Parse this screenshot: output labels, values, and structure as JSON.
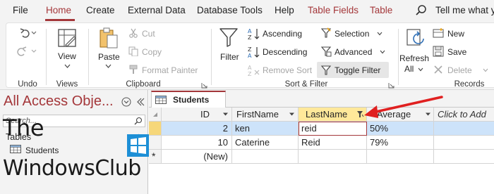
{
  "menubar": {
    "tabs": [
      "File",
      "Home",
      "Create",
      "External Data",
      "Database Tools",
      "Help",
      "Table Fields",
      "Table"
    ],
    "active_tab": "Home",
    "tell_me": "Tell me what y"
  },
  "ribbon": {
    "undo": {
      "group": "Undo"
    },
    "views": {
      "view_label": "View",
      "group": "Views"
    },
    "clipboard": {
      "paste": "Paste",
      "cut": "Cut",
      "copy": "Copy",
      "format_painter": "Format Painter",
      "group": "Clipboard"
    },
    "sort_filter": {
      "filter": "Filter",
      "ascending": "Ascending",
      "descending": "Descending",
      "remove_sort": "Remove Sort",
      "selection": "Selection",
      "advanced": "Advanced",
      "toggle_filter": "Toggle Filter",
      "group": "Sort & Filter"
    },
    "records": {
      "refresh": "Refresh",
      "refresh_all": "All",
      "new": "New",
      "save": "Save",
      "delete": "Delete",
      "group": "Records"
    }
  },
  "navpane": {
    "title": "All Access Obje...",
    "search_placeholder": "Search...",
    "group": "Tables",
    "items": [
      "Students"
    ]
  },
  "watermark": {
    "line1": "The",
    "line2": "WindowsClub"
  },
  "document": {
    "tab": "Students",
    "columns": [
      "ID",
      "FirstName",
      "LastName",
      "Average",
      "Click to Add"
    ],
    "rows": [
      {
        "id": "2",
        "first": "ken",
        "last": "reid",
        "average": "50%"
      },
      {
        "id": "10",
        "first": "Caterine",
        "last": "Reid",
        "average": "79%"
      }
    ],
    "new_row": "(New)"
  },
  "colors": {
    "accent": "#a4373a",
    "selected_row": "#cde3fa",
    "filtered_header": "#ffe89a",
    "arrow": "#e02020"
  }
}
